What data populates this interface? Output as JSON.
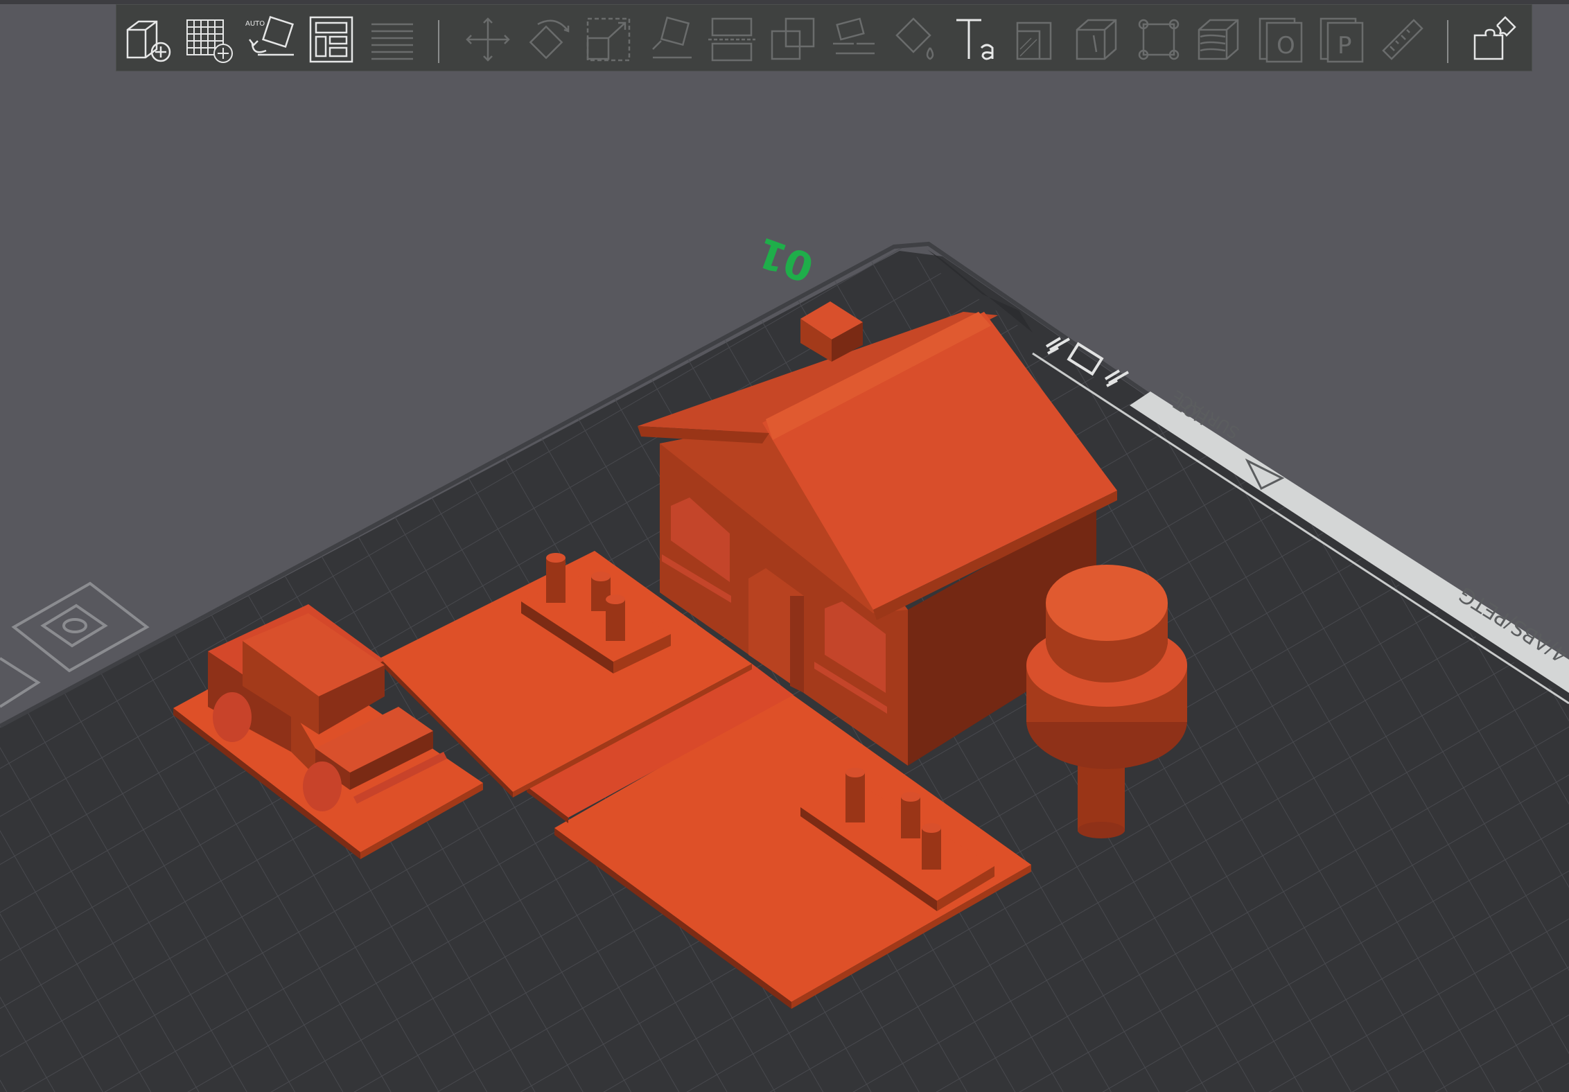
{
  "toolbar": {
    "groups": [
      {
        "name": "add-object",
        "enabled": true
      },
      {
        "name": "add-plate",
        "enabled": true
      },
      {
        "name": "auto-orient",
        "enabled": true,
        "label": "AUTO"
      },
      {
        "name": "arrange",
        "enabled": true
      },
      {
        "name": "layers",
        "enabled": false
      },
      {
        "name": "move",
        "enabled": false
      },
      {
        "name": "rotate",
        "enabled": false
      },
      {
        "name": "scale",
        "enabled": false
      },
      {
        "name": "lay-on-face",
        "enabled": false
      },
      {
        "name": "cut",
        "enabled": false
      },
      {
        "name": "boolean",
        "enabled": false
      },
      {
        "name": "support-paint",
        "enabled": false
      },
      {
        "name": "color-paint",
        "enabled": false
      },
      {
        "name": "text",
        "enabled": true
      },
      {
        "name": "variable-layer-height",
        "enabled": false
      },
      {
        "name": "seam-paint",
        "enabled": false
      },
      {
        "name": "fuzzy-skin",
        "enabled": false
      },
      {
        "name": "measure-mesh",
        "enabled": false
      },
      {
        "name": "object-label",
        "enabled": false,
        "label": "O"
      },
      {
        "name": "plate-label",
        "enabled": false,
        "label": "P"
      },
      {
        "name": "measure",
        "enabled": false
      },
      {
        "name": "assembly",
        "enabled": true
      }
    ]
  },
  "plate": {
    "number": "01",
    "warning_text_line1": "HOT",
    "warning_text_line2": "SURFACE",
    "filament_text": "4/ABS/PETG"
  },
  "colors": {
    "background": "#58585e",
    "model": "#d94e2b",
    "plate_number": "#1fae4a",
    "bed": "#343538"
  }
}
